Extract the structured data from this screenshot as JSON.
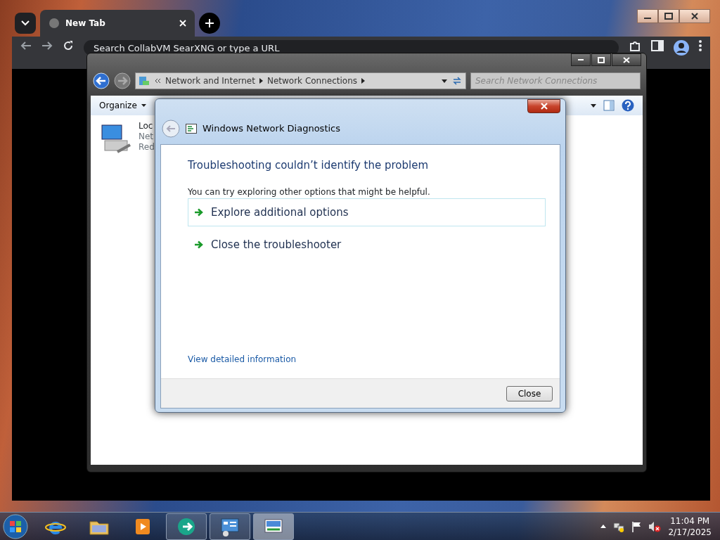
{
  "browser": {
    "tabs": [
      {
        "label": "New Tab",
        "selected": true
      }
    ],
    "address_bar": {
      "placeholder": "Search CollabVM SearXNG or type a URL"
    }
  },
  "explorer": {
    "breadcrumb": [
      {
        "label": "Network and Internet"
      },
      {
        "label": "Network Connections"
      }
    ],
    "search": {
      "placeholder": "Search Network Connections"
    },
    "toolbar": [
      {
        "label": "Organize"
      }
    ],
    "connection": {
      "name": "Loc",
      "line_2": "Net",
      "line_3": "Red"
    }
  },
  "dialog": {
    "title": "Windows Network Diagnostics",
    "heading": "Troubleshooting couldn’t identify the problem",
    "message": "You can try exploring other options that might be helpful.",
    "options": [
      {
        "label": "Explore additional options",
        "selected": true
      },
      {
        "label": "Close the troubleshooter",
        "selected": false
      }
    ],
    "details_link": "View detailed information",
    "buttons": [
      "Close"
    ]
  },
  "taskbar": {
    "items": [
      {
        "kind": "browser",
        "running": false,
        "selected": false
      },
      {
        "kind": "folder",
        "running": false,
        "selected": false
      },
      {
        "kind": "media",
        "running": false,
        "selected": false
      },
      {
        "kind": "app",
        "running": true,
        "selected": false
      },
      {
        "kind": "panel",
        "running": true,
        "selected": false
      },
      {
        "kind": "diagnostics",
        "running": true,
        "selected": true
      }
    ],
    "clock": {
      "time": "11:04 PM",
      "date": "2/17/2025"
    }
  }
}
